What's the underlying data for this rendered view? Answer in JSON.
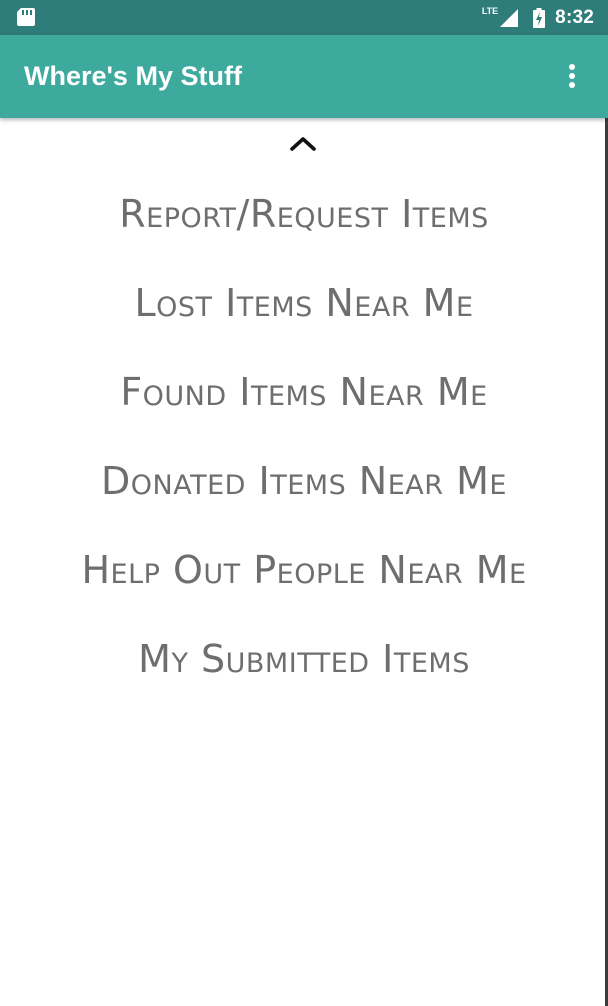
{
  "status_bar": {
    "network_type": "LTE",
    "time": "8:32",
    "icons": {
      "sd_card": "sd-card-icon",
      "signal": "signal-icon",
      "battery": "battery-charging-icon"
    }
  },
  "app_bar": {
    "title": "Where's My Stuff",
    "overflow_icon": "more-vert-icon",
    "background": "#3eaa9e"
  },
  "content": {
    "scroll_indicator_icon": "chevron-up-icon",
    "menu_items": [
      "Report/Request Items",
      "Lost Items Near Me",
      "Found Items Near Me",
      "Donated Items Near Me",
      "Help Out People Near Me",
      "My Submitted Items"
    ]
  },
  "colors": {
    "status_bar": "#2f7d7a",
    "app_bar": "#3eaa9e",
    "menu_text": "#6e6e6e"
  }
}
